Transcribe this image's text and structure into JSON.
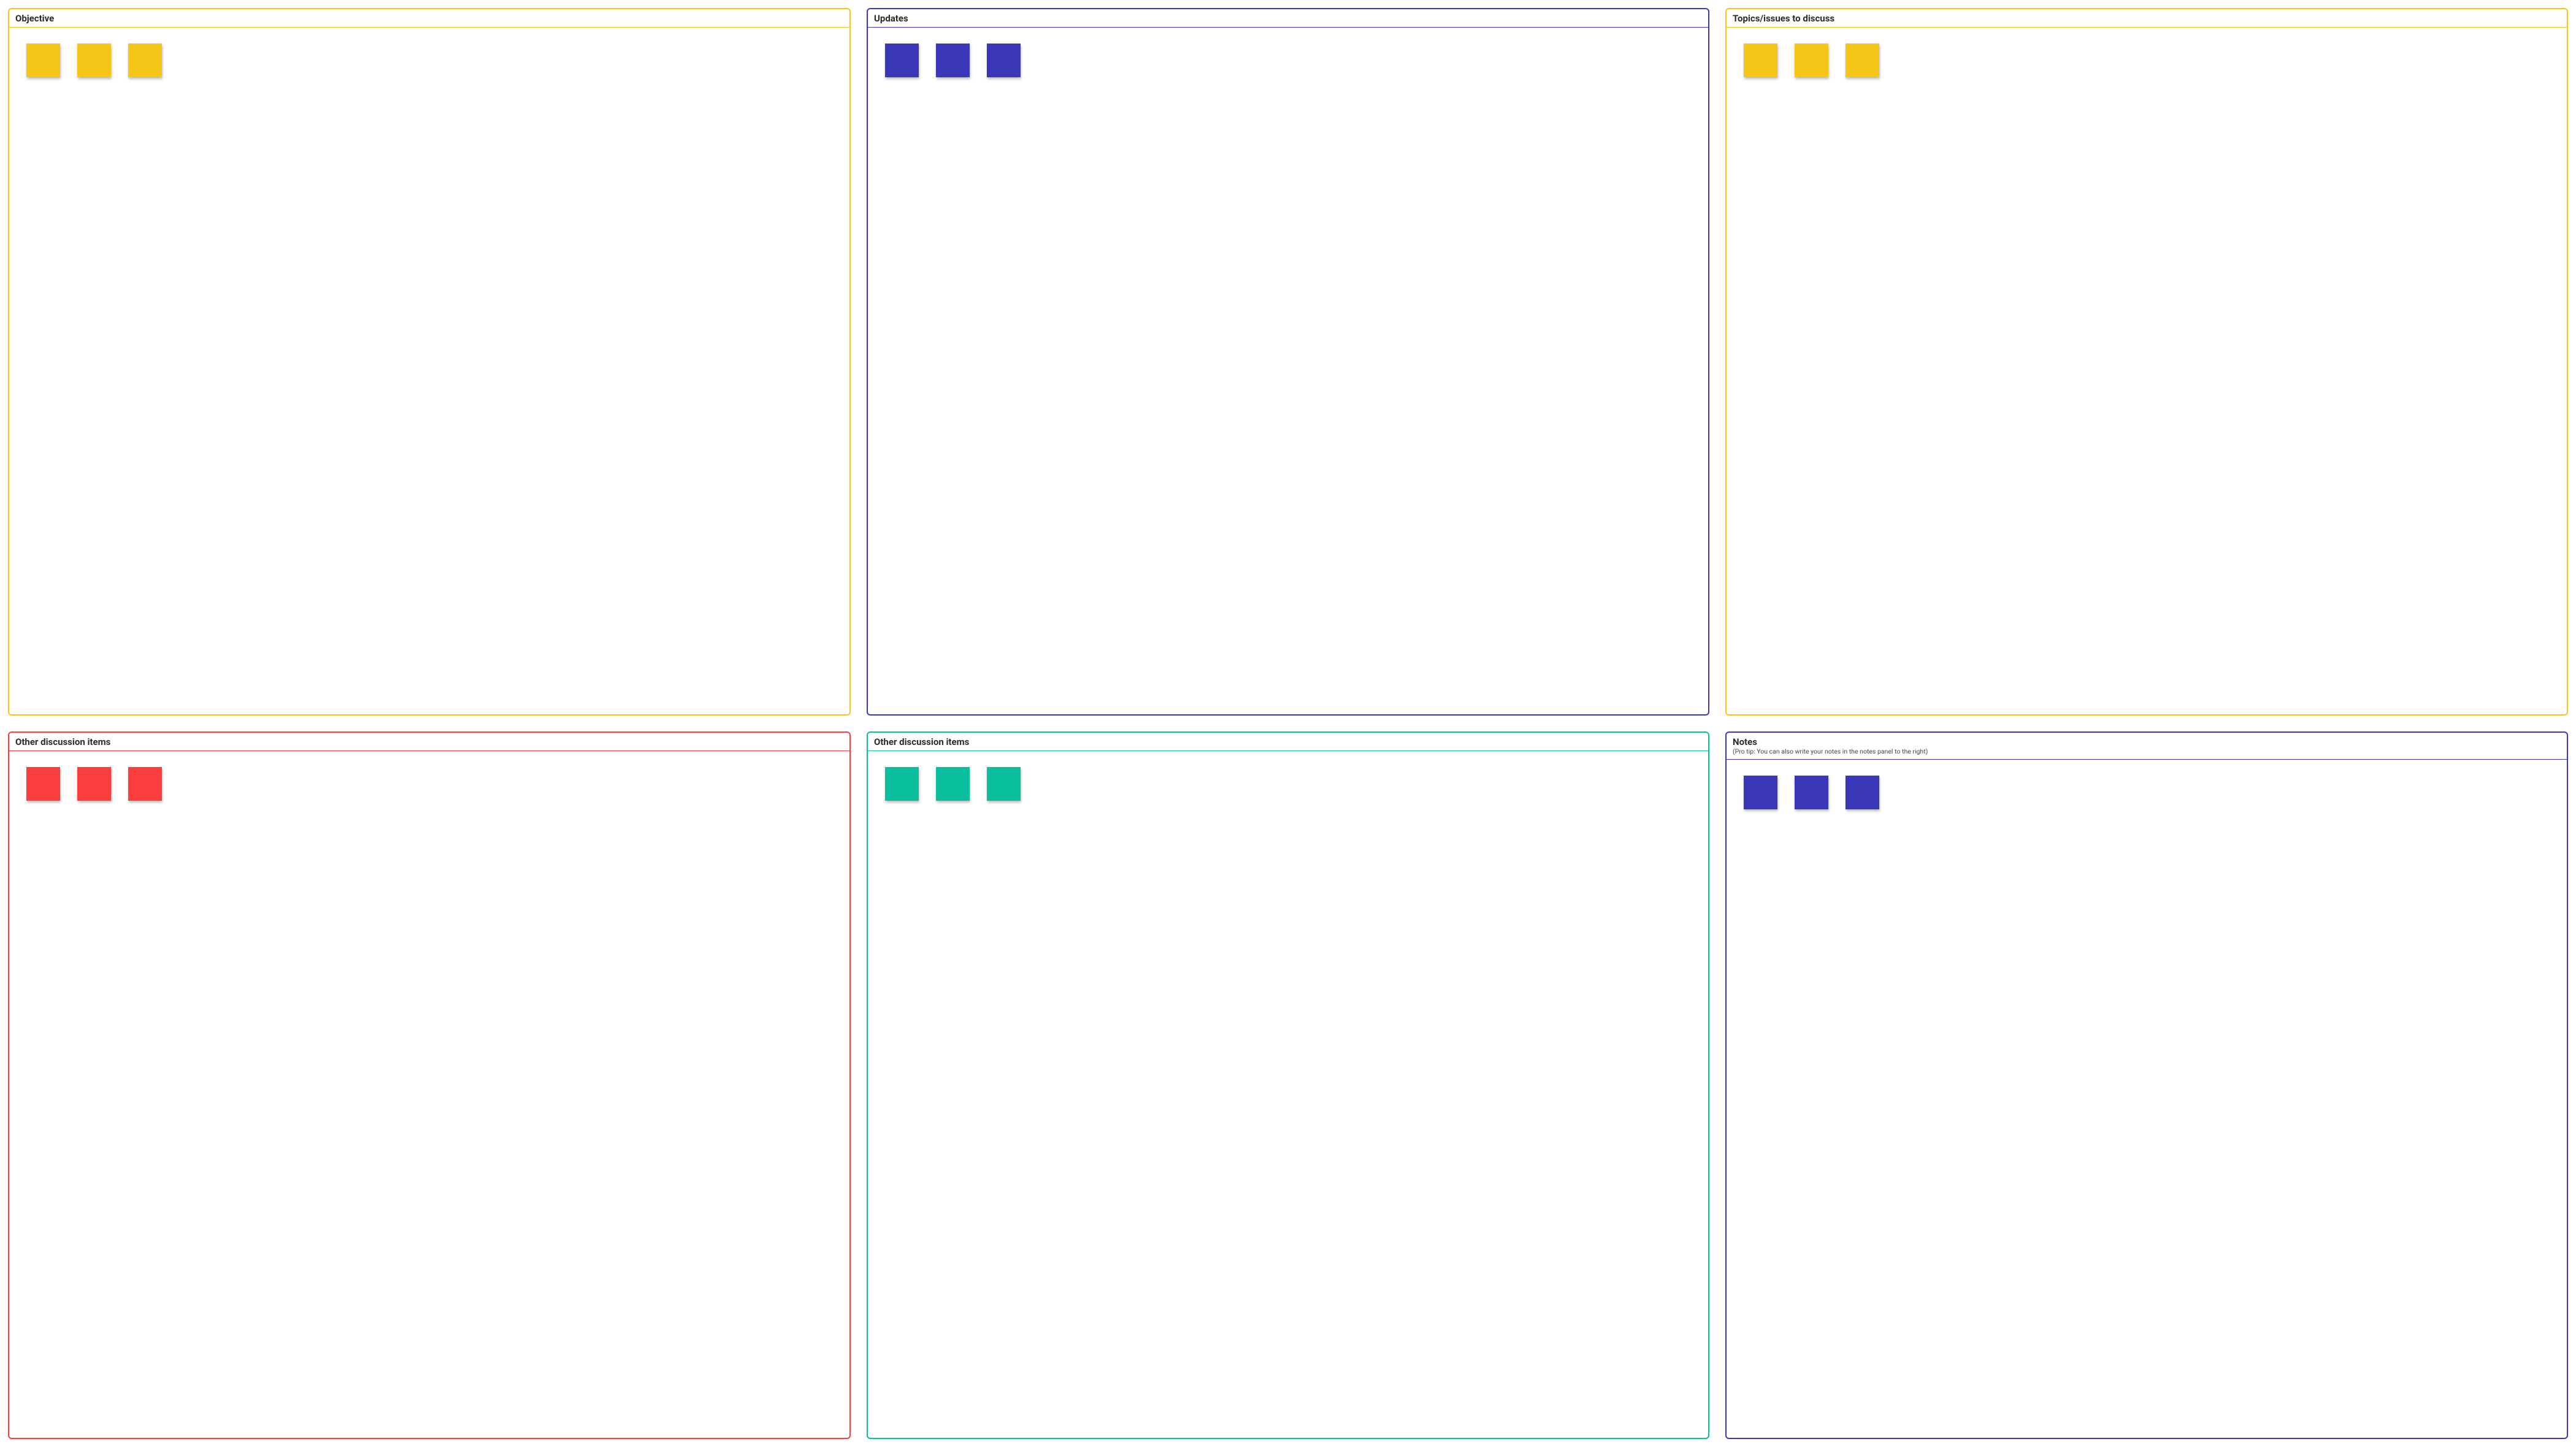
{
  "colors": {
    "yellow": "#F5C518",
    "blue": "#3A38B8",
    "red": "#FC3D3D",
    "teal": "#0ABF9E"
  },
  "panels": {
    "objective": {
      "title": "Objective",
      "border_color": "yellow",
      "sticky_color": "yellow",
      "sticky_count": 3
    },
    "updates": {
      "title": "Updates",
      "border_color": "blue",
      "sticky_color": "blue",
      "sticky_count": 3
    },
    "topics": {
      "title": "Topics/issues to discuss",
      "border_color": "yellow",
      "sticky_color": "yellow",
      "sticky_count": 3
    },
    "other1": {
      "title": "Other discussion items",
      "border_color": "red",
      "sticky_color": "red",
      "sticky_count": 3
    },
    "other2": {
      "title": "Other discussion items",
      "border_color": "teal",
      "sticky_color": "teal",
      "sticky_count": 3
    },
    "notes": {
      "title": "Notes",
      "subtitle": "(Pro tip: You can also write your notes in the notes panel to the right)",
      "border_color": "blue",
      "sticky_color": "blue",
      "sticky_count": 3
    }
  }
}
